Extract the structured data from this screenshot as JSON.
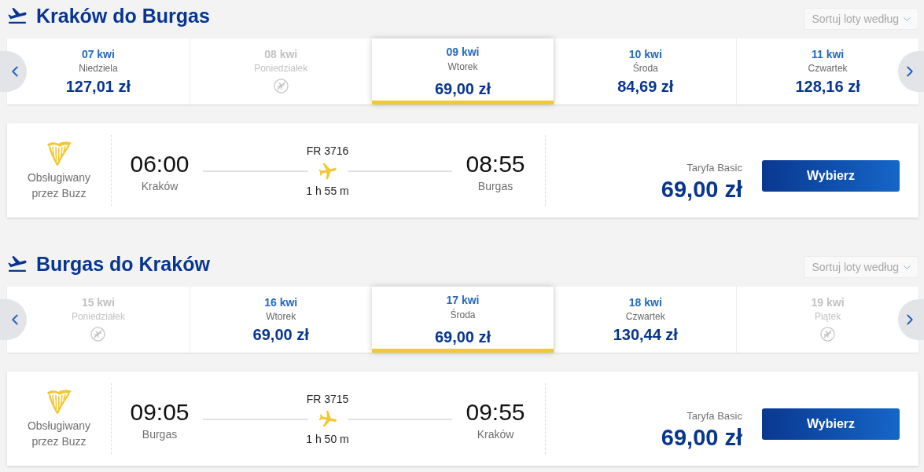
{
  "sections": [
    {
      "kind": "outbound",
      "title": "Kraków do Burgas",
      "sort": {
        "label": "Sortuj loty według"
      },
      "days": [
        {
          "date": "07 kwi",
          "weekday": "Niedziela",
          "price": "127,01 zł",
          "disabled": false,
          "selected": false
        },
        {
          "date": "08 kwi",
          "weekday": "Poniedziałek",
          "disabled": true,
          "selected": false
        },
        {
          "date": "09 kwi",
          "weekday": "Wtorek",
          "price": "69,00 zł",
          "disabled": false,
          "selected": true
        },
        {
          "date": "10 kwi",
          "weekday": "Środa",
          "price": "84,69 zł",
          "disabled": false,
          "selected": false
        },
        {
          "date": "11 kwi",
          "weekday": "Czwartek",
          "price": "128,16 zł",
          "disabled": false,
          "selected": false
        }
      ],
      "flight": {
        "operator": "Obsługiwany przez Buzz",
        "flight_number": "FR 3716",
        "departure": {
          "time": "06:00",
          "city": "Kraków"
        },
        "arrival": {
          "time": "08:55",
          "city": "Burgas"
        },
        "duration": "1 h 55 m",
        "fare": "Taryfa Basic",
        "price": "69,00 zł",
        "button": "Wybierz"
      }
    },
    {
      "kind": "inbound",
      "title": "Burgas do Kraków",
      "sort": {
        "label": "Sortuj loty według"
      },
      "days": [
        {
          "date": "15 kwi",
          "weekday": "Poniedziałek",
          "disabled": true,
          "selected": false
        },
        {
          "date": "16 kwi",
          "weekday": "Wtorek",
          "price": "69,00 zł",
          "disabled": false,
          "selected": false
        },
        {
          "date": "17 kwi",
          "weekday": "Środa",
          "price": "69,00 zł",
          "disabled": false,
          "selected": true
        },
        {
          "date": "18 kwi",
          "weekday": "Czwartek",
          "price": "130,44 zł",
          "disabled": false,
          "selected": false
        },
        {
          "date": "19 kwi",
          "weekday": "Piątek",
          "disabled": true,
          "selected": false
        }
      ],
      "flight": {
        "operator": "Obsługiwany przez Buzz",
        "flight_number": "FR 3715",
        "departure": {
          "time": "09:05",
          "city": "Burgas"
        },
        "arrival": {
          "time": "09:55",
          "city": "Kraków"
        },
        "duration": "1 h 50 m",
        "fare": "Taryfa Basic",
        "price": "69,00 zł",
        "button": "Wybierz"
      }
    }
  ]
}
